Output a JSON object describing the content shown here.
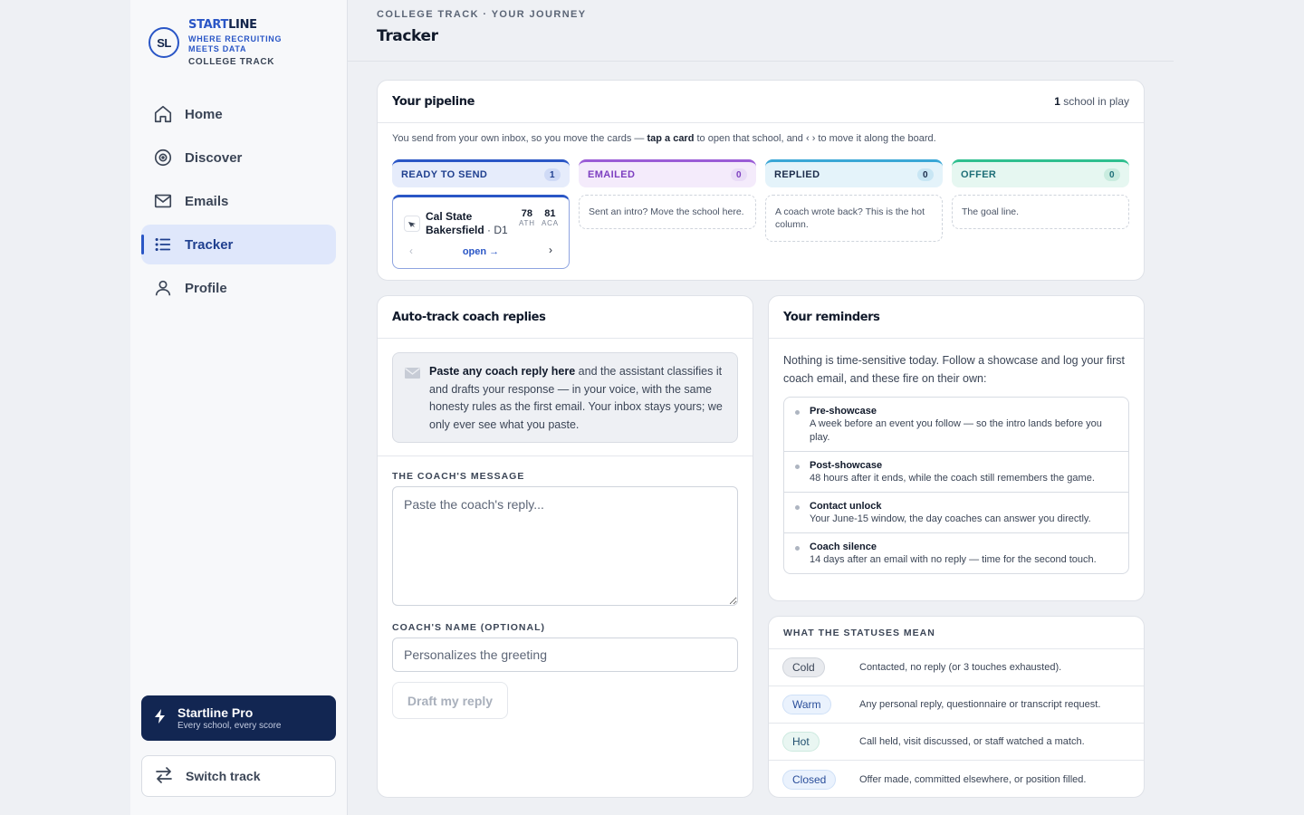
{
  "brand": {
    "logo_text": "SL",
    "name_part1": "START",
    "name_part2": "LINE",
    "tagline": "WHERE RECRUITING MEETS DATA",
    "track": "COLLEGE TRACK"
  },
  "nav": {
    "items": [
      {
        "label": "Home",
        "icon": "home-icon"
      },
      {
        "label": "Discover",
        "icon": "target-icon"
      },
      {
        "label": "Emails",
        "icon": "mail-icon"
      },
      {
        "label": "Tracker",
        "icon": "list-icon",
        "active": true
      },
      {
        "label": "Profile",
        "icon": "user-icon"
      }
    ]
  },
  "pro": {
    "title": "Startline Pro",
    "subtitle": "Every school, every score"
  },
  "switch_track": {
    "label": "Switch track"
  },
  "header": {
    "eyebrow": "COLLEGE TRACK · YOUR JOURNEY",
    "title": "Tracker"
  },
  "pipeline": {
    "title": "Your pipeline",
    "in_play_count": "1",
    "in_play_text": "school in play",
    "hint_pre": "You send from your own inbox, so you move the cards — ",
    "hint_bold": "tap a card",
    "hint_post": " to open that school, and ‹ › to move it along the board.",
    "columns": [
      {
        "label": "READY TO SEND",
        "count": "1"
      },
      {
        "label": "EMAILED",
        "count": "0",
        "empty_text": "Sent an intro? Move the school here."
      },
      {
        "label": "REPLIED",
        "count": "0",
        "empty_text": "A coach wrote back? This is the hot column."
      },
      {
        "label": "OFFER",
        "count": "0",
        "empty_text": "The goal line."
      }
    ],
    "school_card": {
      "name": "Cal State Bakersfield",
      "division": "· D1",
      "ath_score": "78",
      "ath_label": "ATH",
      "aca_score": "81",
      "aca_label": "ACA",
      "prev": "‹",
      "open": "open →",
      "next": "›"
    }
  },
  "autotrack": {
    "title": "Auto-track coach replies",
    "info_bold": "Paste any coach reply here",
    "info_rest": " and the assistant classifies it and drafts your response — in your voice, with the same honesty rules as the first email. Your inbox stays yours; we only ever see what you paste.",
    "message_label": "THE COACH'S MESSAGE",
    "message_placeholder": "Paste the coach's reply...",
    "name_label": "COACH'S NAME (OPTIONAL)",
    "name_placeholder": "Personalizes the greeting",
    "draft_button": "Draft my reply"
  },
  "reminders": {
    "title": "Your reminders",
    "intro": "Nothing is time-sensitive today. Follow a showcase and log your first coach email, and these fire on their own:",
    "items": [
      {
        "title": "Pre-showcase",
        "desc": "A week before an event you follow — so the intro lands before you play."
      },
      {
        "title": "Post-showcase",
        "desc": "48 hours after it ends, while the coach still remembers the game."
      },
      {
        "title": "Contact unlock",
        "desc": "Your June-15 window, the day coaches can answer you directly."
      },
      {
        "title": "Coach silence",
        "desc": "14 days after an email with no reply — time for the second touch."
      }
    ]
  },
  "statuses": {
    "title": "WHAT THE STATUSES MEAN",
    "items": [
      {
        "label": "Cold",
        "desc": "Contacted, no reply (or 3 touches exhausted).",
        "bg": "#e8eaee",
        "border": "#d0d4db",
        "color": "#3b4556"
      },
      {
        "label": "Warm",
        "desc": "Any personal reply, questionnaire or transcript request.",
        "bg": "#eaf2fd",
        "border": "#cfe0f7",
        "color": "#2a4e9a"
      },
      {
        "label": "Hot",
        "desc": "Call held, visit discussed, or staff watched a match.",
        "bg": "#e9f6f2",
        "border": "#cdeae0",
        "color": "#1f4d6e"
      },
      {
        "label": "Closed",
        "desc": "Offer made, committed elsewhere, or position filled.",
        "bg": "#eaf2fd",
        "border": "#cfe0f7",
        "color": "#2a4e9a"
      }
    ]
  },
  "colors": {
    "accent": "#2a56c6",
    "navy": "#122652",
    "col_ready": "#2a56c6",
    "col_emailed": "#9a5cd6",
    "col_replied": "#3aa7d6",
    "col_offer": "#2fbf8f"
  }
}
